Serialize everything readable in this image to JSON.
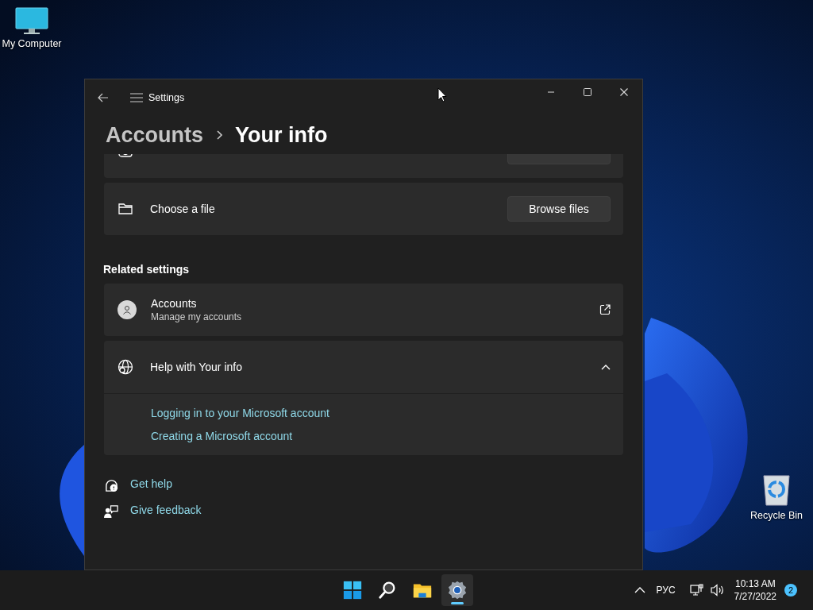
{
  "desktop_icons": [
    {
      "kind": "computer",
      "label": "My Computer"
    },
    {
      "kind": "recycle",
      "label": "Recycle Bin"
    }
  ],
  "window": {
    "title": "Settings",
    "breadcrumb": [
      "Accounts",
      "Your info"
    ]
  },
  "photo_options": [
    {
      "kind": "camera"
    },
    {
      "kind": "folder",
      "label": "Choose a file",
      "button": "Browse files"
    }
  ],
  "related_settings": {
    "heading": "Related settings",
    "items": [
      {
        "title": "Accounts",
        "subtitle": "Manage my accounts"
      }
    ]
  },
  "help": {
    "title": "Help with Your info",
    "expanded": true,
    "links": [
      "Logging in to your Microsoft account",
      "Creating a Microsoft account"
    ]
  },
  "footer_links": [
    {
      "kind": "help",
      "label": "Get help"
    },
    {
      "kind": "feedback",
      "label": "Give feedback"
    }
  ],
  "taskbar": {
    "apps": [
      {
        "kind": "start",
        "selected": false
      },
      {
        "kind": "search",
        "selected": false
      },
      {
        "kind": "explorer",
        "selected": false
      },
      {
        "kind": "settings",
        "selected": true
      }
    ],
    "language": "РУС",
    "time": "10:13 AM",
    "date": "7/27/2022",
    "notifications": "2"
  }
}
